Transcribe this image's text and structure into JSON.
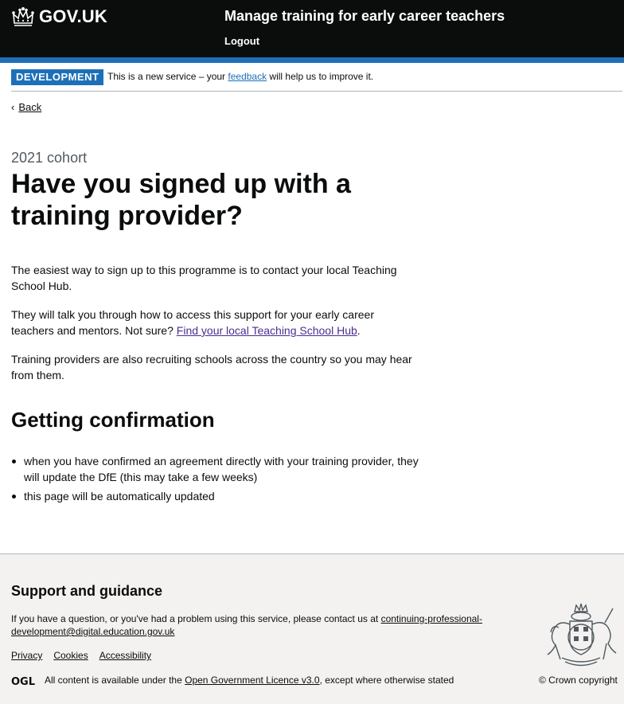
{
  "header": {
    "logo_text": "GOV.UK",
    "service_name": "Manage training for early career teachers",
    "logout_label": "Logout",
    "icons": {
      "logo": "crown-icon"
    }
  },
  "phase_banner": {
    "tag": "DEVELOPMENT",
    "text_before": "This is a new service – your ",
    "link_text": "feedback",
    "text_after": " will help us to improve it."
  },
  "back_link": {
    "chevron": "‹",
    "label": "Back"
  },
  "main": {
    "caption": "2021 cohort",
    "heading": "Have you signed up with a training provider?",
    "para1": "The easiest way to sign up to this programme is to contact your local Teaching School Hub.",
    "para2_before": "They will talk you through how to access this support for your early career teachers and mentors. Not sure? ",
    "para2_link": "Find your local Teaching School Hub",
    "para2_after": ".",
    "para3": "Training providers are also recruiting schools across the country so you may hear from them.",
    "confirmation_heading": "Getting confirmation",
    "bullets": [
      "when you have confirmed an agreement directly with your training provider, they will update the DfE (this may take a few weeks)",
      "this page will be automatically updated"
    ]
  },
  "footer": {
    "heading": "Support and guidance",
    "support_text": "If you have a question, or you've had a problem using this service, please contact us at ",
    "support_email": "continuing-professional-development@digital.education.gov.uk",
    "links": [
      "Privacy",
      "Cookies",
      "Accessibility"
    ],
    "ogl_logo_text": "OGL",
    "licence_before": "All content is available under the ",
    "licence_link": "Open Government Licence v3.0",
    "licence_after": ", except where otherwise stated",
    "copyright": "© Crown copyright",
    "icons": {
      "ogl": "ogl-logo-icon",
      "crest": "royal-coat-of-arms-icon"
    }
  },
  "colors": {
    "header_bg": "#0b0c0c",
    "header_border": "#1d70b8",
    "phase_tag": "#1d70b8",
    "link": "#1d70b8",
    "visited_link": "#4c2c92",
    "caption": "#505a5f",
    "footer_bg": "#f3f2f1"
  }
}
